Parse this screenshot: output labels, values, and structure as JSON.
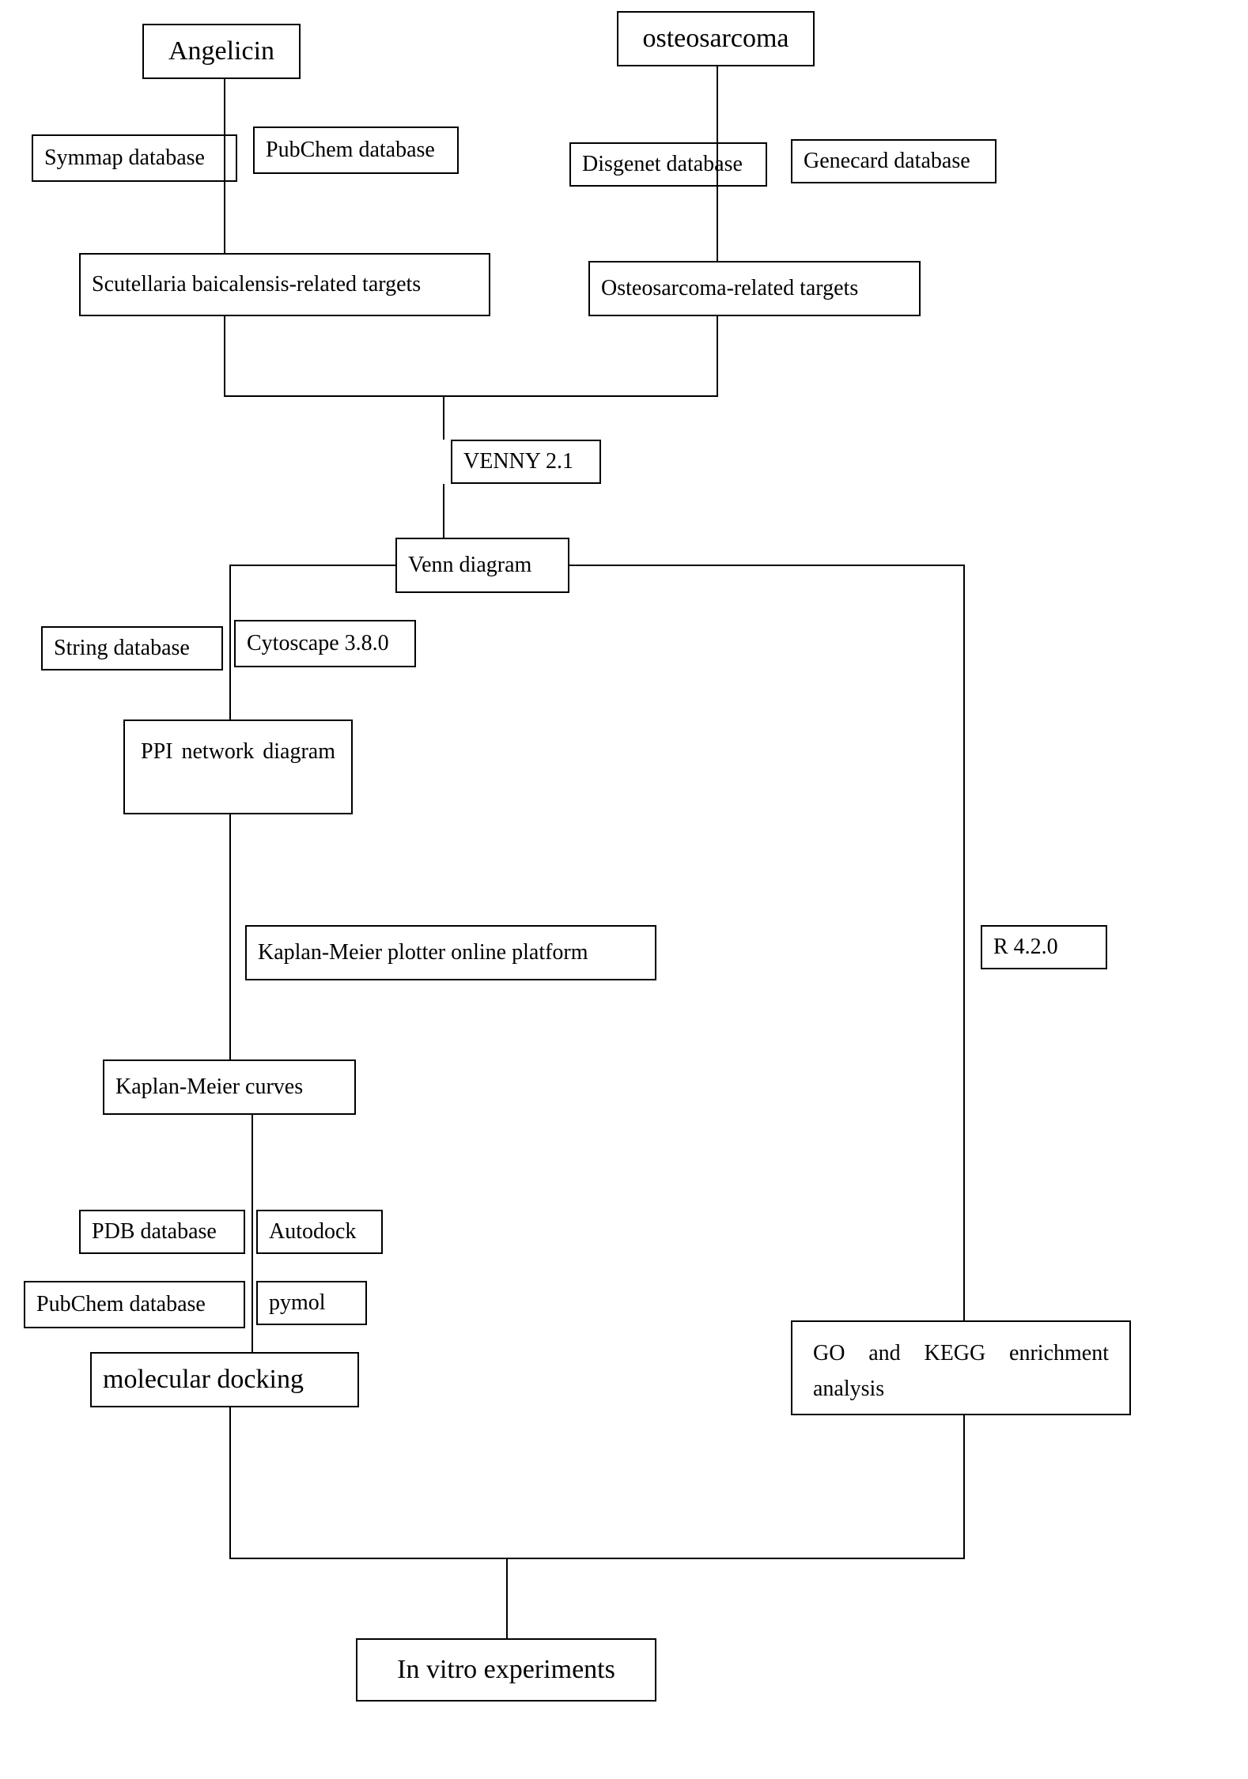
{
  "nodes": {
    "angelicin": "Angelicin",
    "osteosarcoma": "osteosarcoma",
    "symmap": "Symmap database",
    "pubchem1": "PubChem database",
    "disgenet": "Disgenet database",
    "genecard": "Genecard database",
    "sb_targets": "Scutellaria baicalensis-related targets",
    "os_targets": "Osteosarcoma-related targets",
    "venny": "VENNY 2.1",
    "venn": "Venn diagram",
    "string": "String database",
    "cytoscape": "Cytoscape 3.8.0",
    "ppi": "PPI network diagram",
    "km_plotter": "Kaplan-Meier plotter online platform",
    "r420": "R 4.2.0",
    "km_curves": "Kaplan-Meier curves",
    "pdb": "PDB database",
    "autodock": "Autodock",
    "pubchem2": "PubChem database",
    "pymol": "pymol",
    "docking": "molecular docking",
    "go_kegg": "GO and KEGG enrichment analysis",
    "invitro": "In vitro experiments"
  }
}
